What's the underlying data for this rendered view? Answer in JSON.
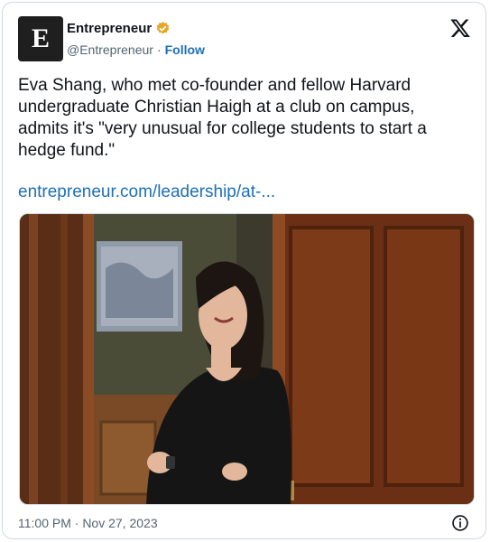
{
  "account": {
    "avatar_letter": "E",
    "name": "Entrepreneur",
    "handle": "@Entrepreneur",
    "separator": "·",
    "follow_label": "Follow"
  },
  "tweet": {
    "text": "Eva Shang, who met co-founder and fellow Harvard undergraduate Christian Haigh at a club on campus, admits it's \"very unusual for college students to start a hedge fund.\"",
    "link_text": "entrepreneur.com/leadership/at-..."
  },
  "footer": {
    "timestamp": "11:00 PM · Nov 27, 2023"
  },
  "colors": {
    "link": "#1d6fb8",
    "verified_badge": "#e8a72a",
    "secondary_text": "#536471"
  },
  "icons": [
    "verified-badge-icon",
    "x-logo-icon",
    "info-icon"
  ]
}
